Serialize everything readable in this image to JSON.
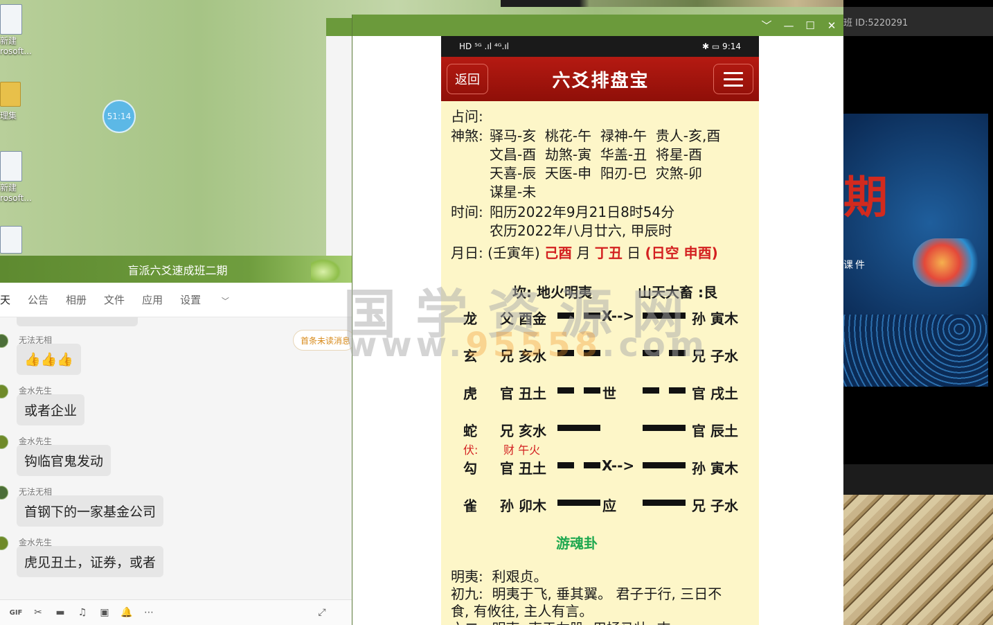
{
  "desktop": {
    "icons": [
      {
        "label_line1": "新建",
        "label_line2": "rosoft..."
      },
      {
        "label_line1": "理集",
        "label_line2": ""
      },
      {
        "label_line1": "新建",
        "label_line2": "rosoft..."
      }
    ],
    "timer_bubble": "51:14"
  },
  "chat": {
    "title": "盲派六爻速成班二期",
    "tabs": [
      "天",
      "公告",
      "相册",
      "文件",
      "应用",
      "设置"
    ],
    "unread_pill": "首条未读消息",
    "messages": [
      {
        "sender": "无法无相",
        "text": "👍👍👍"
      },
      {
        "sender": "金水先生",
        "text": "或者企业"
      },
      {
        "sender": "金水先生",
        "text": "钩临官鬼发动"
      },
      {
        "sender": "无法无相",
        "text": "首钢下的一家基金公司"
      },
      {
        "sender": "金水先生",
        "text": "虎见丑土，证券，或者"
      }
    ],
    "toolbar": [
      "GIF",
      "✂",
      "▬",
      "♫",
      "▣",
      "🔔",
      "⋯",
      "⤢"
    ]
  },
  "phone_window": {
    "controls": [
      "﹀",
      "—",
      "☐",
      "✕"
    ],
    "status_bar": {
      "left": "HD ⁵ᴳ .ıl ⁴ᴳ.ıl",
      "right": "✱ ▭ 9:14"
    },
    "app": {
      "back": "返回",
      "title": "六爻排盘宝",
      "zhanwen": "占问:",
      "shensha_label": "神煞:",
      "shensha_rows": [
        "驿马-亥  桃花-午  禄神-午  贵人-亥,酉",
        "文昌-酉  劫煞-寅  华盖-丑  将星-酉",
        "天喜-辰  天医-申  阳刃-巳  灾煞-卯",
        "谋星-未"
      ],
      "time_label": "时间:",
      "time_rows": [
        "阳历2022年9月21日8时54分",
        "农历2022年八月廿六, 甲辰时"
      ],
      "yueri_label": "月日:",
      "yueri_year": "(壬寅年)",
      "yueri_month": "己酉",
      "yueri_month_unit": "月",
      "yueri_day": "丁丑",
      "yueri_day_unit": "日",
      "yueri_kong": "(日空 申酉)",
      "gua_main": "坎: 地火明夷",
      "gua_change": "山天大畜 :艮",
      "yao": [
        {
          "beast": "龙",
          "left": "父 酉金",
          "mark": "X-->",
          "right": "孙 寅木"
        },
        {
          "beast": "玄",
          "left": "兄 亥水",
          "mark": "",
          "right": "兄 子水"
        },
        {
          "beast": "虎",
          "left": "官 丑土",
          "mark": "世",
          "right": "官 戌土"
        },
        {
          "beast": "蛇",
          "left": "兄 亥水",
          "mark": "",
          "right": "官 辰土"
        },
        {
          "beast": "勾",
          "left": "官 丑土",
          "mark": "X-->",
          "right": "孙 寅木"
        },
        {
          "beast": "雀",
          "left": "孙 卯木",
          "mark": "应",
          "right": "兄 子水"
        }
      ],
      "fu_label": "伏:",
      "fu_value": "财 午火",
      "youhun": "游魂卦",
      "guaci_rows": [
        "明夷:  利艰贞。",
        "初九:  明夷于飞, 垂其翼。 君子于行, 三日不",
        "食, 有攸往, 主人有言。",
        "六二:  明夷, 夷于左股, 用拯马壮, 吉。"
      ]
    },
    "watermark": {
      "line1": "国学资源网",
      "line2_a": "www.",
      "line2_b": "95558",
      "line2_c": ".com"
    }
  },
  "video": {
    "topbar_id": "班 ID:5220291",
    "slide_char": "期",
    "slide_sub": "课件"
  }
}
